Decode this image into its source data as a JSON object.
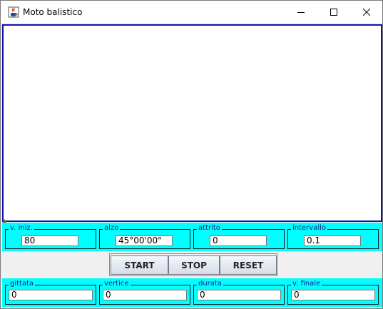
{
  "window": {
    "title": "Moto balistico"
  },
  "inputs": [
    {
      "label": "v. iniz.",
      "value": "80"
    },
    {
      "label": "alzo",
      "value": "45°00'00\""
    },
    {
      "label": "attrito",
      "value": "0"
    },
    {
      "label": "intervallo",
      "value": "0.1"
    }
  ],
  "buttons": {
    "start": "START",
    "stop": "STOP",
    "reset": "RESET"
  },
  "outputs": [
    {
      "label": "gittata",
      "value": "0"
    },
    {
      "label": "vertice",
      "value": "0"
    },
    {
      "label": "durata",
      "value": "0"
    },
    {
      "label": "v. finale",
      "value": "0"
    }
  ],
  "colors": {
    "panel": "#00ffff",
    "canvas_border": "#1010b0",
    "canvas_bg": "#ffffff"
  },
  "icons": {
    "app": "java-cup-icon",
    "minimize": "minimize-icon",
    "maximize": "maximize-icon",
    "close": "close-icon"
  }
}
